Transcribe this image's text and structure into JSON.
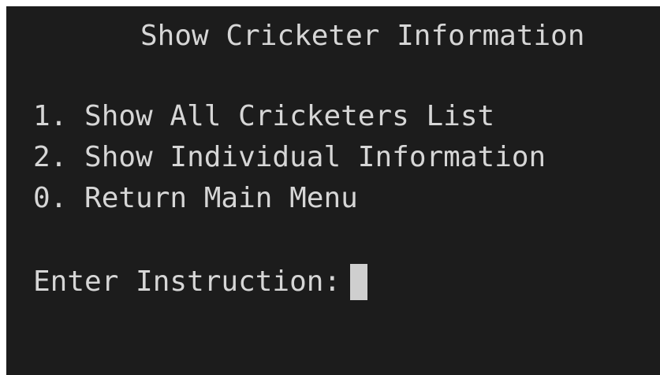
{
  "terminal": {
    "title": "Show Cricketer Information",
    "menu_items": [
      "1. Show All Cricketers List",
      "2. Show Individual Information",
      "0. Return Main Menu"
    ],
    "prompt": "Enter Instruction:",
    "input_value": "",
    "colors": {
      "background": "#1c1c1c",
      "text": "#d6d6d6",
      "cursor": "#cfcfcf"
    }
  }
}
